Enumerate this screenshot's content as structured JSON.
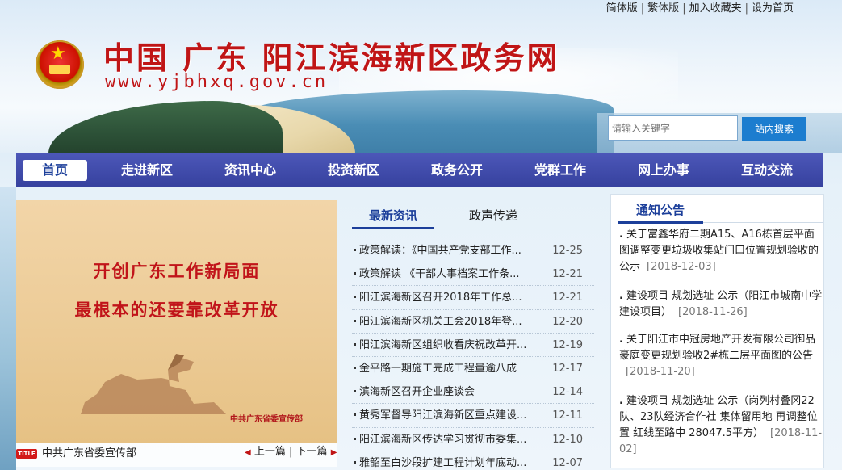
{
  "header": {
    "site_title": "中国 广东 阳江滨海新区政务网",
    "site_url": "www.yjbhxq.gov.cn",
    "top_links": [
      "简体版",
      "繁体版",
      "加入收藏夹",
      "设为首页"
    ],
    "search": {
      "placeholder": "请输入关键字",
      "button_label": "站内搜索"
    }
  },
  "nav": {
    "items": [
      "首页",
      "走进新区",
      "资讯中心",
      "投资新区",
      "政务公开",
      "党群工作",
      "网上办事",
      "互动交流"
    ],
    "active_index": 0
  },
  "poster": {
    "line1": "开创广东工作新局面",
    "line2": "最根本的还要靠改革开放",
    "credit": "中共广东省委宣传部",
    "caption_tag": "TITLE",
    "caption": "中共广东省委宣传部",
    "prev_label": "上一篇",
    "next_label": "下一篇"
  },
  "news": {
    "tabs": [
      "最新资讯",
      "政声传递"
    ],
    "active_tab": 0,
    "items": [
      {
        "title": "政策解读：《中国共产党支部工作...",
        "date": "12-25"
      },
      {
        "title": "政策解读 《干部人事档案工作条...",
        "date": "12-21"
      },
      {
        "title": "阳江滨海新区召开2018年工作总...",
        "date": "12-21"
      },
      {
        "title": "阳江滨海新区机关工会2018年登...",
        "date": "12-20"
      },
      {
        "title": "阳江滨海新区组织收看庆祝改革开...",
        "date": "12-19"
      },
      {
        "title": "金平路一期施工完成工程量逾八成",
        "date": "12-17"
      },
      {
        "title": "滨海新区召开企业座谈会",
        "date": "12-14"
      },
      {
        "title": "黄秀军督导阳江滨海新区重点建设...",
        "date": "12-11"
      },
      {
        "title": "阳江滨海新区传达学习贯彻市委集...",
        "date": "12-10"
      },
      {
        "title": "雅韶至白沙段扩建工程计划年底动...",
        "date": "12-07"
      }
    ]
  },
  "notices": {
    "heading": "通知公告",
    "items": [
      {
        "text": "关于富鑫华府二期A15、A16栋首层平面图调整变更垃圾收集站门口位置规划验收的公示",
        "date": "[2018-12-03]"
      },
      {
        "text": "建设项目 规划选址 公示（阳江市城南中学建设项目）",
        "date": "[2018-11-26]"
      },
      {
        "text": "关于阳江市中冠房地产开发有限公司御品豪庭变更规划验收2#栋二层平面图的公告",
        "date": "[2018-11-20]"
      },
      {
        "text": "建设项目 规划选址 公示（岗列村叠冈22队、23队经济合作社 集体留用地 再调整位置 红线至路中 28047.5平方）",
        "date": "[2018-11-02]"
      }
    ]
  },
  "colors": {
    "title_red": "#c01516",
    "nav_blue": "#3d48a8",
    "accent_blue": "#1c3f9a",
    "search_button": "#1c7dcf"
  }
}
